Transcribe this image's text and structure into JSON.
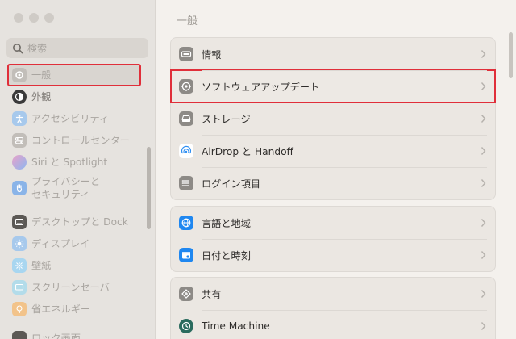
{
  "sidebar": {
    "search_placeholder": "検索",
    "items": [
      {
        "label": "一般",
        "icon": "gear-icon",
        "color": "#c2beb9",
        "active": true
      },
      {
        "label": "外観",
        "icon": "appearance-icon",
        "color": "#3a3a3a"
      },
      {
        "label": "アクセシビリティ",
        "icon": "accessibility-icon",
        "color": "#a7c9ec"
      },
      {
        "label": "コントロールセンター",
        "icon": "control-center-icon",
        "color": "#c2beb9"
      },
      {
        "label": "Siri と Spotlight",
        "icon": "siri-icon",
        "color": "#c89bd4"
      },
      {
        "label": "プライバシーと\nセキュリティ",
        "icon": "hand-icon",
        "color": "#8ab4e8"
      },
      {
        "label": "デスクトップと Dock",
        "icon": "dock-icon",
        "color": "#5c5955"
      },
      {
        "label": "ディスプレイ",
        "icon": "display-icon",
        "color": "#a7c9ec"
      },
      {
        "label": "壁紙",
        "icon": "wallpaper-icon",
        "color": "#a8d6f0"
      },
      {
        "label": "スクリーンセーバ",
        "icon": "screensaver-icon",
        "color": "#b3dcea"
      },
      {
        "label": "省エネルギー",
        "icon": "battery-icon",
        "color": "#f2c38a"
      },
      {
        "label": "ロック画面",
        "icon": "lock-icon",
        "color": "#5c5955"
      }
    ]
  },
  "main": {
    "title": "一般",
    "groups": [
      [
        {
          "label": "情報",
          "icon": "info-icon",
          "color": "#8d8a86"
        },
        {
          "label": "ソフトウェアアップデート",
          "icon": "software-update-icon",
          "color": "#8d8a86",
          "highlight": true
        },
        {
          "label": "ストレージ",
          "icon": "storage-icon",
          "color": "#8d8a86"
        },
        {
          "label": "AirDrop と Handoff",
          "icon": "airdrop-icon",
          "color": "#ffffff"
        },
        {
          "label": "ログイン項目",
          "icon": "login-items-icon",
          "color": "#8d8a86"
        }
      ],
      [
        {
          "label": "言語と地域",
          "icon": "globe-icon",
          "color": "#1f87f0"
        },
        {
          "label": "日付と時刻",
          "icon": "calendar-icon",
          "color": "#1f87f0"
        }
      ],
      [
        {
          "label": "共有",
          "icon": "sharing-icon",
          "color": "#8d8a86"
        },
        {
          "label": "Time Machine",
          "icon": "time-machine-icon",
          "color": "#2a6b5e"
        }
      ]
    ]
  }
}
